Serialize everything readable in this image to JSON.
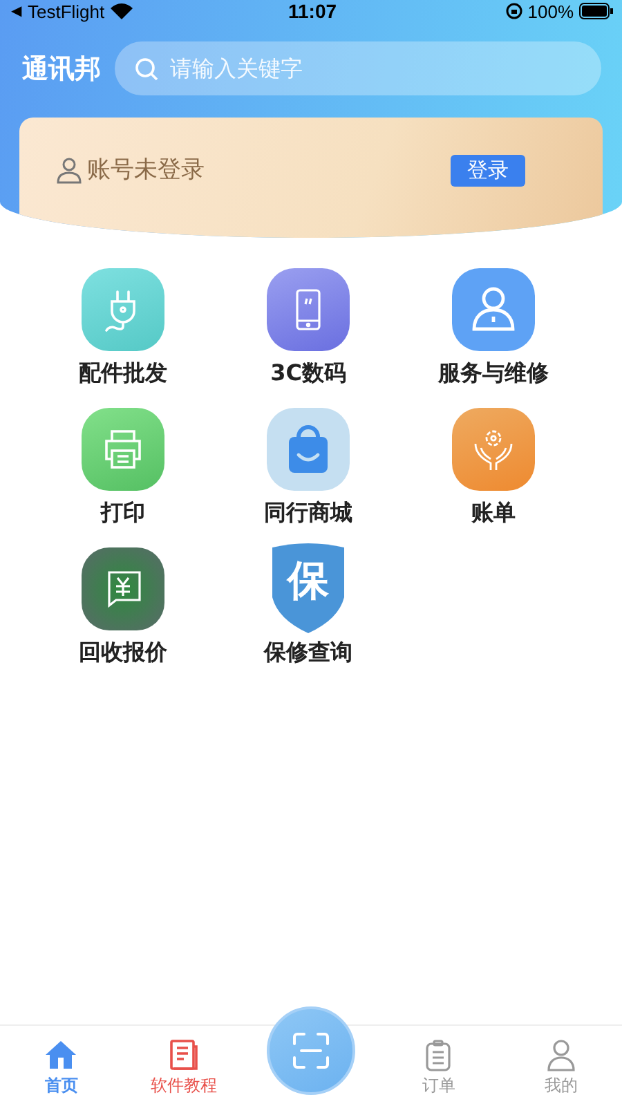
{
  "status_bar": {
    "back_arrow": "◀",
    "back_app": "TestFlight",
    "time": "11:07",
    "battery": "100%"
  },
  "header": {
    "logo": "通讯邦",
    "search": {
      "placeholder": "请输入关键字"
    }
  },
  "account_card": {
    "text": "账号未登录",
    "login_button": "登录"
  },
  "services": [
    {
      "label": "配件批发",
      "kind": "plug"
    },
    {
      "label": "3C数码",
      "kind": "phone"
    },
    {
      "label": "服务与维修",
      "kind": "person"
    },
    {
      "label": "打印",
      "kind": "printer"
    },
    {
      "label": "同行商城",
      "kind": "bag"
    },
    {
      "label": "账单",
      "kind": "hands"
    },
    {
      "label": "回收报价",
      "kind": "yen"
    },
    {
      "label": "保修查询",
      "kind": "shield",
      "badge_text": "保"
    }
  ],
  "tab_bar": [
    {
      "label": "首页",
      "kind": "home",
      "selected": true,
      "color": "#4a8ff0"
    },
    {
      "label": "软件教程",
      "kind": "doc",
      "selected": false,
      "color": "#e8504a"
    },
    {
      "kind": "scan",
      "selected": false
    },
    {
      "label": "订单",
      "kind": "clipboard",
      "selected": false,
      "color": "#999999"
    },
    {
      "label": "我的",
      "kind": "user",
      "selected": false,
      "color": "#999999"
    }
  ]
}
